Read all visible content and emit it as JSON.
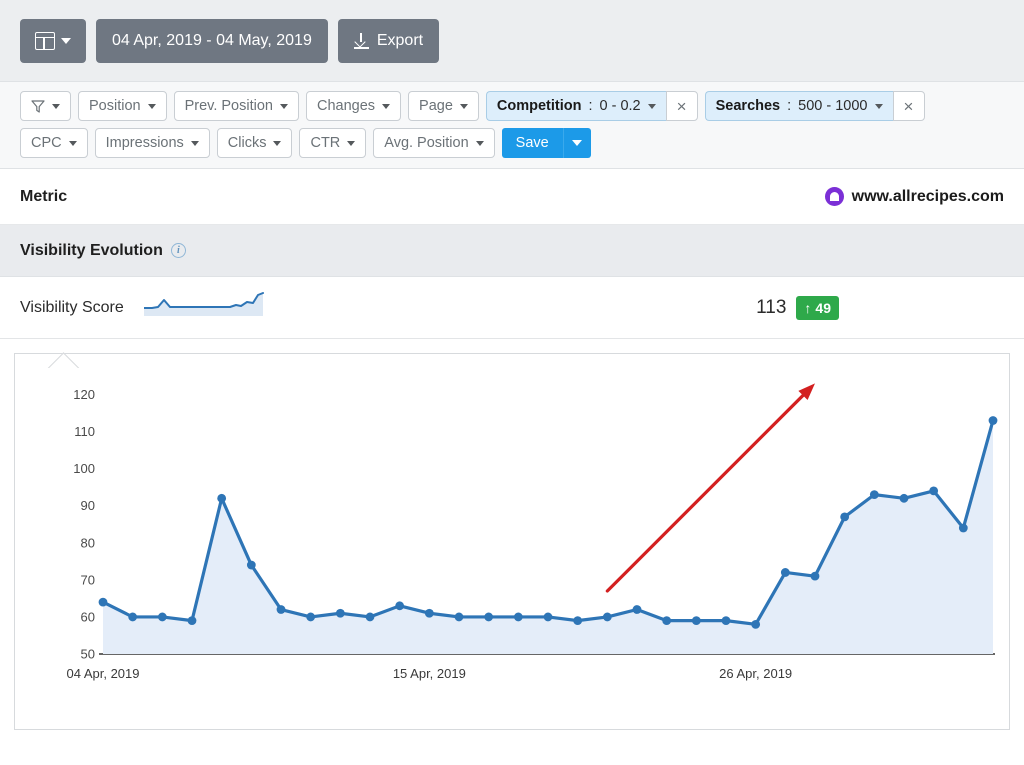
{
  "toolbar": {
    "layout_icon": "grid-layout-icon",
    "date_range": "04 Apr, 2019 - 04 May, 2019",
    "export_label": "Export",
    "export_icon": "download-icon"
  },
  "filters": {
    "funnel_icon": "funnel-icon",
    "row1": [
      {
        "label": "Position"
      },
      {
        "label": "Prev. Position"
      },
      {
        "label": "Changes"
      },
      {
        "label": "Page"
      }
    ],
    "active": [
      {
        "name": "Competition",
        "sep": " : ",
        "value": "0 - 0.2",
        "close": "×"
      },
      {
        "name": "Searches",
        "sep": " : ",
        "value": "500 - 1000",
        "close": "×"
      }
    ],
    "row2": [
      {
        "label": "CPC"
      },
      {
        "label": "Impressions"
      },
      {
        "label": "Clicks"
      },
      {
        "label": "CTR"
      },
      {
        "label": "Avg. Position"
      }
    ],
    "save_label": "Save"
  },
  "metric_header": {
    "label": "Metric",
    "domain": "www.allrecipes.com",
    "favicon_color": "#7b2fd6"
  },
  "section": {
    "title": "Visibility Evolution",
    "info_icon": "info-icon",
    "info_glyph": "i"
  },
  "score": {
    "label": "Visibility Score",
    "value": "113",
    "change_arrow": "↑",
    "change_value": "49",
    "badge_color": "#2ea94a"
  },
  "chart_data": {
    "type": "line",
    "title": "Visibility Evolution",
    "xlabel": "",
    "ylabel": "Visibility Score",
    "ylim": [
      50,
      125
    ],
    "yticks": [
      50,
      60,
      70,
      80,
      90,
      100,
      110,
      120
    ],
    "xtick_labels": [
      "04 Apr, 2019",
      "15 Apr, 2019",
      "26 Apr, 2019"
    ],
    "xtick_indices": [
      0,
      11,
      22
    ],
    "grid": false,
    "legend": null,
    "line_color": "#2e75b6",
    "fill_color": "#e4edf9",
    "marker_color": "#2e75b6",
    "annotation": {
      "type": "arrow",
      "color": "#d32020",
      "from_index": 17,
      "from_value": 67,
      "to_index": 24,
      "to_value": 123
    },
    "x": [
      "04 Apr, 2019",
      "05 Apr, 2019",
      "06 Apr, 2019",
      "07 Apr, 2019",
      "08 Apr, 2019",
      "09 Apr, 2019",
      "10 Apr, 2019",
      "11 Apr, 2019",
      "12 Apr, 2019",
      "13 Apr, 2019",
      "14 Apr, 2019",
      "15 Apr, 2019",
      "16 Apr, 2019",
      "17 Apr, 2019",
      "18 Apr, 2019",
      "19 Apr, 2019",
      "20 Apr, 2019",
      "21 Apr, 2019",
      "22 Apr, 2019",
      "23 Apr, 2019",
      "24 Apr, 2019",
      "25 Apr, 2019",
      "26 Apr, 2019",
      "27 Apr, 2019",
      "28 Apr, 2019",
      "29 Apr, 2019",
      "30 Apr, 2019",
      "01 May, 2019",
      "02 May, 2019",
      "03 May, 2019",
      "04 May, 2019"
    ],
    "values": [
      64,
      60,
      60,
      59,
      92,
      74,
      62,
      60,
      61,
      60,
      63,
      61,
      60,
      60,
      60,
      60,
      59,
      60,
      62,
      59,
      59,
      59,
      58,
      72,
      71,
      87,
      93,
      92,
      94,
      84,
      113
    ]
  }
}
